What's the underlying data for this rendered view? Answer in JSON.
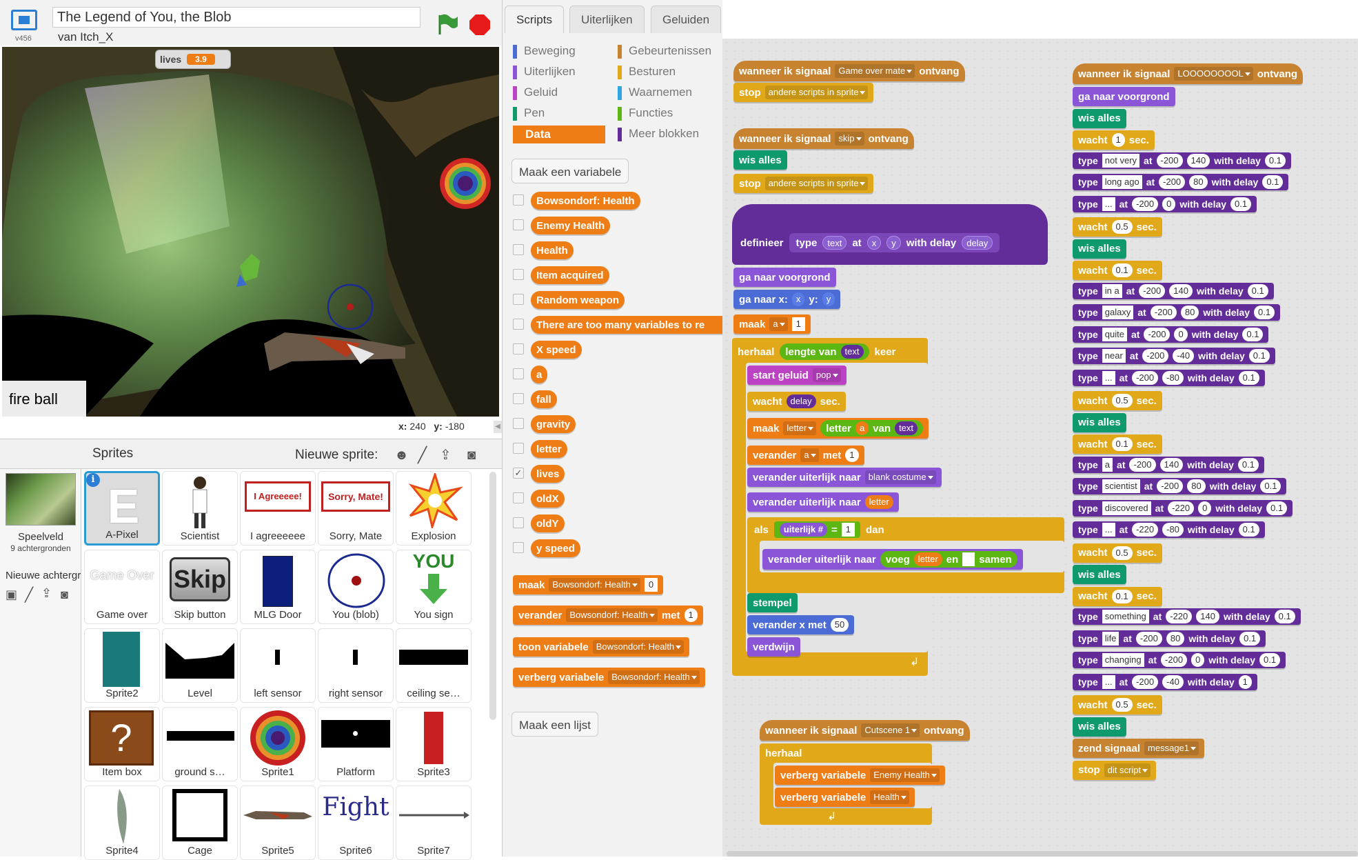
{
  "project": {
    "title": "The Legend of You, the Blob",
    "author": "van Itch_X",
    "version": "v456"
  },
  "stage": {
    "var_name": "lives",
    "var_value": "3.9",
    "fire_label": "fire ball",
    "x_label": "x:",
    "x_value": "240",
    "y_label": "y:",
    "y_value": "-180"
  },
  "sprites_panel": {
    "title": "Sprites",
    "new_sprite_label": "Nieuwe sprite:",
    "stage_name": "Speelveld",
    "stage_sub": "9 achtergronden",
    "new_backdrop": "Nieuwe achtergr",
    "sprites": [
      "A-Pixel",
      "Scientist",
      "I agreeeeee",
      "Sorry, Mate",
      "Explosion",
      "Game over",
      "Skip button",
      "MLG Door",
      "You (blob)",
      "You sign",
      "Sprite2",
      "Level",
      "left sensor",
      "right sensor",
      "ceiling se…",
      "Item box",
      "ground s…",
      "Sprite1",
      "Platform",
      "Sprite3",
      "Sprite4",
      "Cage",
      "Sprite5",
      "Sprite6",
      "Sprite7"
    ],
    "thumb_text": {
      "agree": "I Agreeeee!",
      "sorry": "Sorry, Mate!",
      "gameover": "Game Over",
      "skip": "Skip",
      "you": "YOU",
      "fight": "Fight",
      "e": "E"
    }
  },
  "tabs": [
    "Scripts",
    "Uiterlijken",
    "Geluiden"
  ],
  "categories_left": [
    "Beweging",
    "Uiterlijken",
    "Geluid",
    "Pen",
    "Data"
  ],
  "categories_right": [
    "Gebeurtenissen",
    "Besturen",
    "Waarnemen",
    "Functies",
    "Meer blokken"
  ],
  "palette": {
    "make_var": "Maak een variabele",
    "make_list": "Maak een lijst",
    "vars": [
      "Bowsondorf: Health",
      "Enemy Health",
      "Health",
      "Item acquired",
      "Random weapon",
      "There are too many variables to re",
      "X speed",
      "a",
      "fall",
      "gravity",
      "letter",
      "lives",
      "oldX",
      "oldY",
      "y speed"
    ],
    "set_label": "maak",
    "change_label": "verander",
    "by_label": "met",
    "show_label": "toon variabele",
    "hide_label": "verberg variabele",
    "var_sel": "Bowsondorf: Health",
    "zero": "0",
    "one": "1",
    "check": "✓"
  },
  "s1": {
    "when": "wanneer ik signaal",
    "msg": "Game over mate",
    "recv": "ontvang",
    "stop": "stop",
    "stop_opt": "andere scripts in sprite"
  },
  "s2": {
    "msg": "skip",
    "clear": "wis alles"
  },
  "s3": {
    "define": "definieer",
    "type": "type",
    "text": "text",
    "at": "at",
    "x": "x",
    "y": "y",
    "with_delay": "with delay",
    "delay": "delay",
    "front": "ga naar voorgrond",
    "goto": "ga naar x:",
    "ylab": "y:",
    "set": "maak",
    "a": "a",
    "one": "1",
    "repeat": "herhaal",
    "length": "lengte van",
    "times": "keer",
    "sound": "start geluid",
    "pop": "pop",
    "wait": "wacht",
    "sec": "sec.",
    "letter": "letter",
    "letter_of": "letter",
    "of": "van",
    "change": "verander",
    "by": "met",
    "costume": "verander uiterlijk naar",
    "blank": "blank costume",
    "if": "als",
    "costume_num": "uiterlijk #",
    "eq": "=",
    "then": "dan",
    "join": "voeg",
    "and": "en",
    "join_end": "samen",
    "blankstr": " ",
    "stamp": "stempel",
    "changex": "verander x met",
    "fifty": "50",
    "hide": "verdwijn",
    "arrow": "↲"
  },
  "s4": {
    "msg": "Cutscene 1",
    "forever": "herhaal",
    "hide_var": "verberg variabele",
    "v1": "Enemy Health",
    "v2": "Health"
  },
  "s5": {
    "msg": "LOOOOOOOOL",
    "send": "zend signaal",
    "message": "message1",
    "stop_this": "dit script",
    "lines": [
      {
        "k": "front"
      },
      {
        "k": "clear"
      },
      {
        "k": "wait",
        "v": "1"
      },
      {
        "k": "type",
        "t": "not very",
        "x": "-200",
        "y": "140",
        "d": "0.1"
      },
      {
        "k": "type",
        "t": "long ago",
        "x": "-200",
        "y": "80",
        "d": "0.1"
      },
      {
        "k": "type",
        "t": "...",
        "x": "-200",
        "y": "0",
        "d": "0.1"
      },
      {
        "k": "wait",
        "v": "0.5"
      },
      {
        "k": "clear"
      },
      {
        "k": "wait",
        "v": "0.1"
      },
      {
        "k": "type",
        "t": "in a",
        "x": "-200",
        "y": "140",
        "d": "0.1"
      },
      {
        "k": "type",
        "t": "galaxy",
        "x": "-200",
        "y": "80",
        "d": "0.1"
      },
      {
        "k": "type",
        "t": "quite",
        "x": "-200",
        "y": "0",
        "d": "0.1"
      },
      {
        "k": "type",
        "t": "near",
        "x": "-200",
        "y": "-40",
        "d": "0.1"
      },
      {
        "k": "type",
        "t": "...",
        "x": "-200",
        "y": "-80",
        "d": "0.1"
      },
      {
        "k": "wait",
        "v": "0.5"
      },
      {
        "k": "clear"
      },
      {
        "k": "wait",
        "v": "0.1"
      },
      {
        "k": "type",
        "t": "a",
        "x": "-200",
        "y": "140",
        "d": "0.1"
      },
      {
        "k": "type",
        "t": "scientist",
        "x": "-200",
        "y": "80",
        "d": "0.1"
      },
      {
        "k": "type",
        "t": "discovered",
        "x": "-220",
        "y": "0",
        "d": "0.1"
      },
      {
        "k": "type",
        "t": "...",
        "x": "-220",
        "y": "-80",
        "d": "0.1"
      },
      {
        "k": "wait",
        "v": "0.5"
      },
      {
        "k": "clear"
      },
      {
        "k": "wait",
        "v": "0.1"
      },
      {
        "k": "type",
        "t": "something",
        "x": "-220",
        "y": "140",
        "d": "0.1"
      },
      {
        "k": "type",
        "t": "life",
        "x": "-200",
        "y": "80",
        "d": "0.1"
      },
      {
        "k": "type",
        "t": "changing",
        "x": "-200",
        "y": "0",
        "d": "0.1"
      },
      {
        "k": "type",
        "t": "...",
        "x": "-200",
        "y": "-40",
        "d": "1"
      },
      {
        "k": "wait",
        "v": "0.5"
      },
      {
        "k": "clear"
      },
      {
        "k": "send"
      },
      {
        "k": "stop"
      }
    ]
  },
  "colors": {
    "data": "#ee7d16",
    "control": "#e1a91a",
    "events": "#c88330",
    "pen": "#0e9a6c",
    "looks": "#8a55d7",
    "motion": "#4a6cd4",
    "sound": "#bb42c3",
    "operators": "#5cb712",
    "more": "#632d99"
  }
}
